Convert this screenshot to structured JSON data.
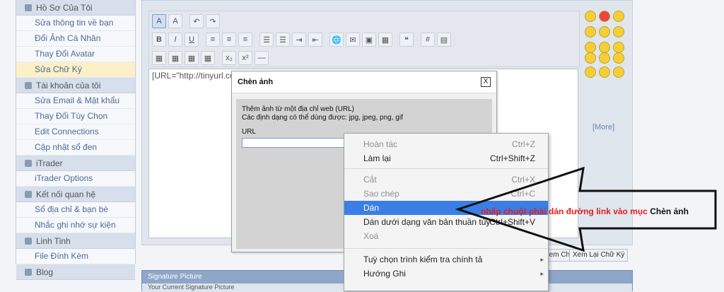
{
  "sidebar": {
    "sections": [
      {
        "header": "Hồ Sơ Của Tôi",
        "items": [
          "Sửa thông tin về bạn",
          "Đổi Ảnh Cá Nhân",
          "Thay Đổi Avatar",
          "Sửa Chữ Ký"
        ]
      },
      {
        "header": "Tài khoản của tôi",
        "items": [
          "Sửa Email & Mật khẩu",
          "Thay Đổi Tùy Chọn",
          "Edit Connections",
          "Cập nhật sổ đen"
        ]
      },
      {
        "header": "iTrader",
        "items": [
          "iTrader Options"
        ]
      },
      {
        "header": "Kết nối quan hệ",
        "items": [
          "Sổ địa chỉ & bạn bè",
          "Nhắc ghi nhớ sự kiện"
        ]
      },
      {
        "header": "Linh Tinh",
        "items": [
          "File Đính Kèm"
        ]
      },
      {
        "header": "Blog",
        "items": []
      }
    ],
    "active_item": "Sửa Chữ Ký"
  },
  "editor": {
    "content": "[URL=\"http://tinyurl.co",
    "more_link": "[More]",
    "buttons": [
      "Xem Chữ Ký",
      "Xem Lại Chữ Ký"
    ]
  },
  "dialog": {
    "title": "Chèn ảnh",
    "close": "X",
    "line1": "Thêm ảnh từ một địa chỉ web (URL)",
    "line2": "Các định dạng có thể dùng được: jpg, jpeg, png, gif",
    "url_label": "URL"
  },
  "context_menu": {
    "items": [
      {
        "label": "Hoàn tác",
        "shortcut": "Ctrl+Z",
        "disabled": true
      },
      {
        "label": "Làm lại",
        "shortcut": "Ctrl+Shift+Z",
        "disabled": false
      },
      {
        "label": "Cắt",
        "shortcut": "Ctrl+X",
        "disabled": true
      },
      {
        "label": "Sao chép",
        "shortcut": "Ctrl+C",
        "disabled": true
      },
      {
        "label": "Dán",
        "shortcut": "",
        "disabled": false,
        "highlight": true
      },
      {
        "label": "Dán dưới dạng văn bản thuần túy",
        "shortcut": "Ctrl+Shift+V",
        "disabled": false
      },
      {
        "label": "Xoá",
        "shortcut": "",
        "disabled": true
      },
      {
        "label": "Tuỳ chọn trình kiểm tra chính tả",
        "shortcut": "▸",
        "disabled": false
      },
      {
        "label": "Hướng Ghi",
        "shortcut": "▸",
        "disabled": false
      }
    ]
  },
  "annotation": {
    "text_red": "nhấp chuột phải dán đường link vào mục ",
    "text_black": "Chèn ảnh"
  },
  "signature_panel": {
    "title": "Signature Picture",
    "subtitle": "Your Current Signature Picture"
  }
}
